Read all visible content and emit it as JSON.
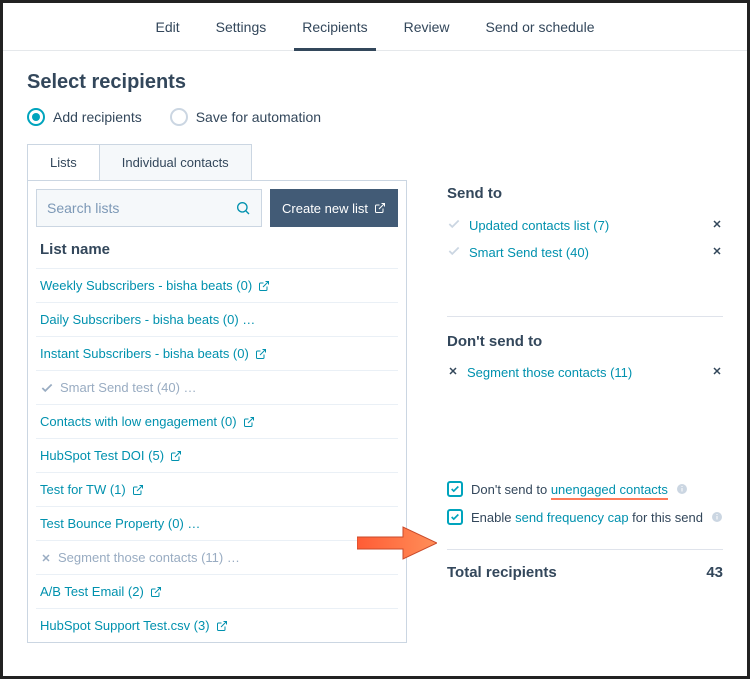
{
  "nav": {
    "items": [
      "Edit",
      "Settings",
      "Recipients",
      "Review",
      "Send or schedule"
    ],
    "active_index": 2
  },
  "title": "Select recipients",
  "mode": {
    "add_label": "Add recipients",
    "save_label": "Save for automation",
    "selected": "add"
  },
  "tabs": {
    "lists": "Lists",
    "contacts": "Individual contacts",
    "active": "lists"
  },
  "search": {
    "placeholder": "Search lists"
  },
  "create_button": "Create new list",
  "list_header": "List name",
  "lists": [
    {
      "label": "Weekly Subscribers - bisha beats (0)",
      "ext": true
    },
    {
      "label": "Daily Subscribers - bisha beats (0) …"
    },
    {
      "label": "Instant Subscribers - bisha beats (0)",
      "ext": true
    },
    {
      "label": "Smart Send test (40) …",
      "state": "selected-muted"
    },
    {
      "label": "Contacts with low engagement (0)",
      "ext": true
    },
    {
      "label": "HubSpot Test DOI (5)",
      "ext": true
    },
    {
      "label": "Test for TW (1)",
      "ext": true
    },
    {
      "label": "Test Bounce Property (0) …"
    },
    {
      "label": "Segment those contacts (11) …",
      "state": "excluded-muted"
    },
    {
      "label": "A/B Test Email (2)",
      "ext": true
    },
    {
      "label": "HubSpot Support Test.csv (3)",
      "ext": true
    }
  ],
  "send_to": {
    "header": "Send to",
    "items": [
      {
        "label": "Updated contacts list (7)"
      },
      {
        "label": "Smart Send test (40)"
      }
    ]
  },
  "dont_send_to": {
    "header": "Don't send to",
    "items": [
      {
        "label": "Segment those contacts (11)"
      }
    ]
  },
  "checkboxes": {
    "unengaged_prefix": "Don't send to ",
    "unengaged_link": "unengaged contacts",
    "freq_prefix": "Enable ",
    "freq_link": "send frequency cap",
    "freq_suffix": " for this send"
  },
  "total": {
    "label": "Total recipients",
    "value": "43"
  }
}
